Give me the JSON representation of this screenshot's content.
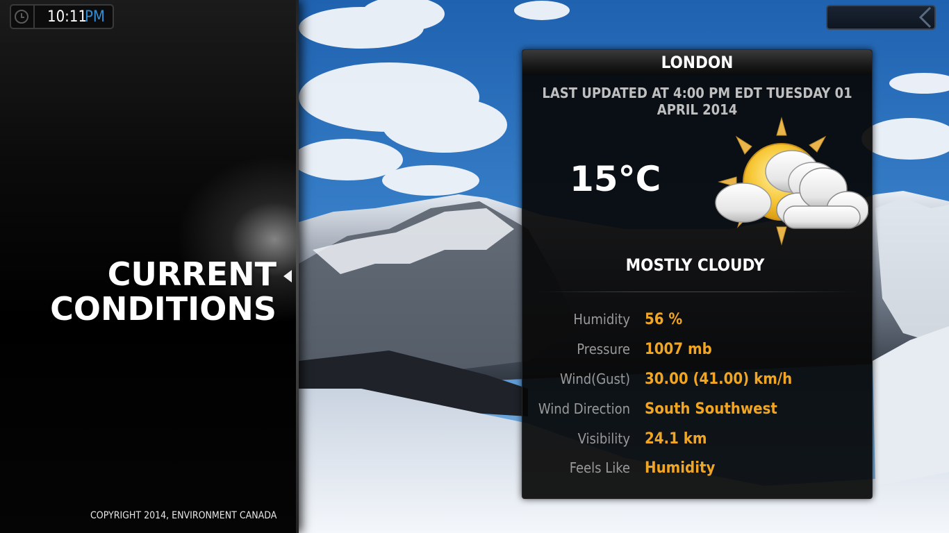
{
  "clock": {
    "time": "10:11",
    "ampm": "PM",
    "icon": "clock-icon"
  },
  "section": {
    "title_line1": "CURRENT",
    "title_line2": "CONDITIONS"
  },
  "footer": {
    "copyright": "COPYRIGHT 2014, ENVIRONMENT CANADA"
  },
  "weather": {
    "city": "LONDON",
    "last_updated": "LAST UPDATED AT 4:00 PM EDT TUESDAY 01 APRIL 2014",
    "temperature": "15°C",
    "condition": "MOSTLY CLOUDY",
    "condition_icon": "partly-cloudy-sun-icon",
    "details": [
      {
        "label": "Humidity",
        "value": "56 %"
      },
      {
        "label": "Pressure",
        "value": "1007 mb"
      },
      {
        "label": "Wind(Gust)",
        "value": "30.00 (41.00) km/h"
      },
      {
        "label": "Wind Direction",
        "value": "South Southwest"
      },
      {
        "label": "Visibility",
        "value": "24.1 km"
      },
      {
        "label": "Feels Like",
        "value": "Humidity"
      }
    ]
  },
  "colors": {
    "accent_value": "#f0a623",
    "ampm": "#2f8fd8",
    "label": "#9a9a9a"
  }
}
